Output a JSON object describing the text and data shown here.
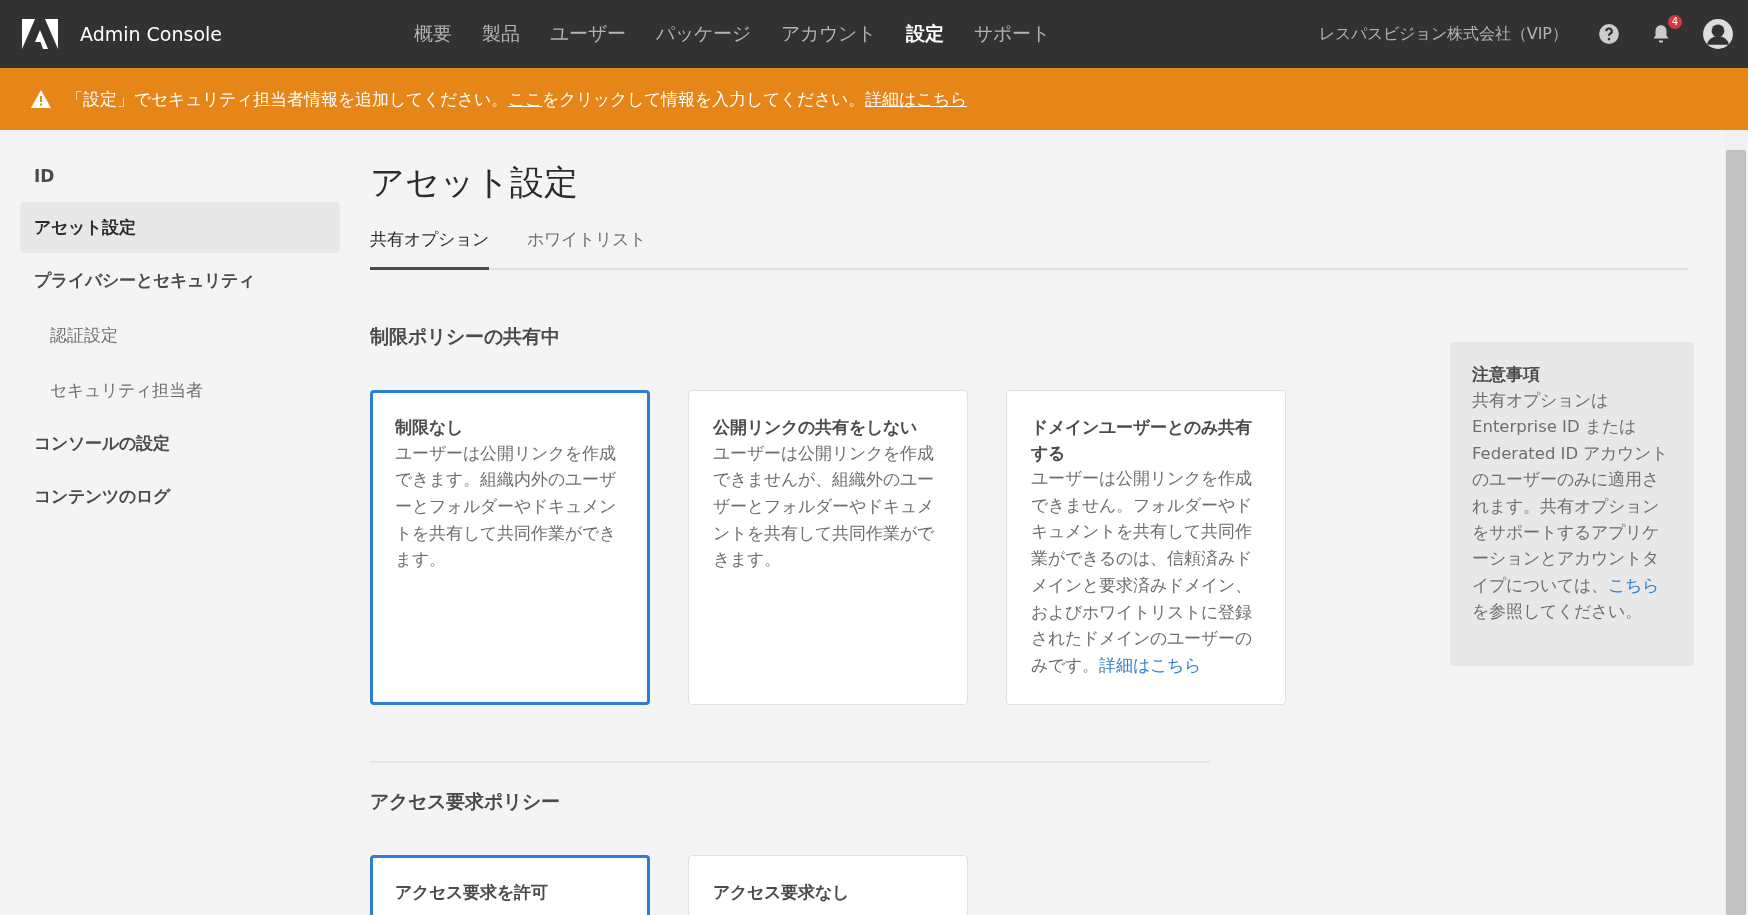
{
  "header": {
    "app_name": "Admin Console",
    "nav": [
      {
        "label": "概要",
        "selected": false
      },
      {
        "label": "製品",
        "selected": false
      },
      {
        "label": "ユーザー",
        "selected": false
      },
      {
        "label": "パッケージ",
        "selected": false
      },
      {
        "label": "アカウント",
        "selected": false
      },
      {
        "label": "設定",
        "selected": true
      },
      {
        "label": "サポート",
        "selected": false
      }
    ],
    "org": "レスパスビジョン株式会社（VIP）",
    "notification_count": "4"
  },
  "banner": {
    "parts": [
      {
        "kind": "text",
        "text": "「設定」でセキュリティ担当者情報を追加してください。"
      },
      {
        "kind": "link",
        "text": "ここ"
      },
      {
        "kind": "text",
        "text": "をクリックして情報を入力してください。"
      },
      {
        "kind": "link",
        "text": "詳細はこちら"
      }
    ]
  },
  "sidebar": {
    "items": [
      {
        "label": "ID",
        "selected": false
      },
      {
        "label": "アセット設定",
        "selected": true
      },
      {
        "label": "プライバシーとセキュリティ",
        "selected": false,
        "children": [
          {
            "label": "認証設定",
            "selected": false
          },
          {
            "label": "セキュリティ担当者",
            "selected": false
          }
        ]
      },
      {
        "label": "コンソールの設定",
        "selected": false
      },
      {
        "label": "コンテンツのログ",
        "selected": false
      }
    ]
  },
  "page": {
    "title": "アセット設定",
    "tabs": [
      {
        "label": "共有オプション",
        "selected": true
      },
      {
        "label": "ホワイトリスト",
        "selected": false
      }
    ],
    "sections": [
      {
        "heading": "制限ポリシーの共有中",
        "options": [
          {
            "title": "制限なし",
            "description": "ユーザーは公開リンクを作成できます。組織内外のユーザーとフォルダーやドキュメントを共有して共同作業ができます。",
            "selected": true
          },
          {
            "title": "公開リンクの共有をしない",
            "description": "ユーザーは公開リンクを作成できませんが、組織外のユーザーとフォルダーやドキュメントを共有して共同作業ができます。",
            "selected": false
          },
          {
            "title": "ドメインユーザーとのみ共有する",
            "description": "ユーザーは公開リンクを作成できません。フォルダーやドキュメントを共有して共同作業ができるのは、信頼済みドメインと要求済みドメイン、およびホワイトリストに登録されたドメインのユーザーのみです。",
            "link": "詳細はこちら",
            "selected": false
          }
        ]
      },
      {
        "heading": "アクセス要求ポリシー",
        "options": [
          {
            "title": "アクセス要求を許可",
            "selected": true
          },
          {
            "title": "アクセス要求なし",
            "selected": false
          }
        ]
      }
    ],
    "note": {
      "title": "注意事項",
      "text_before": "共有オプションは Enterprise ID または Federated ID アカウントのユーザーのみに適用されます。共有オプションをサポートするアプリケーションとアカウントタイプについては、",
      "link": "こちら",
      "text_after": "を参照してください。"
    }
  }
}
